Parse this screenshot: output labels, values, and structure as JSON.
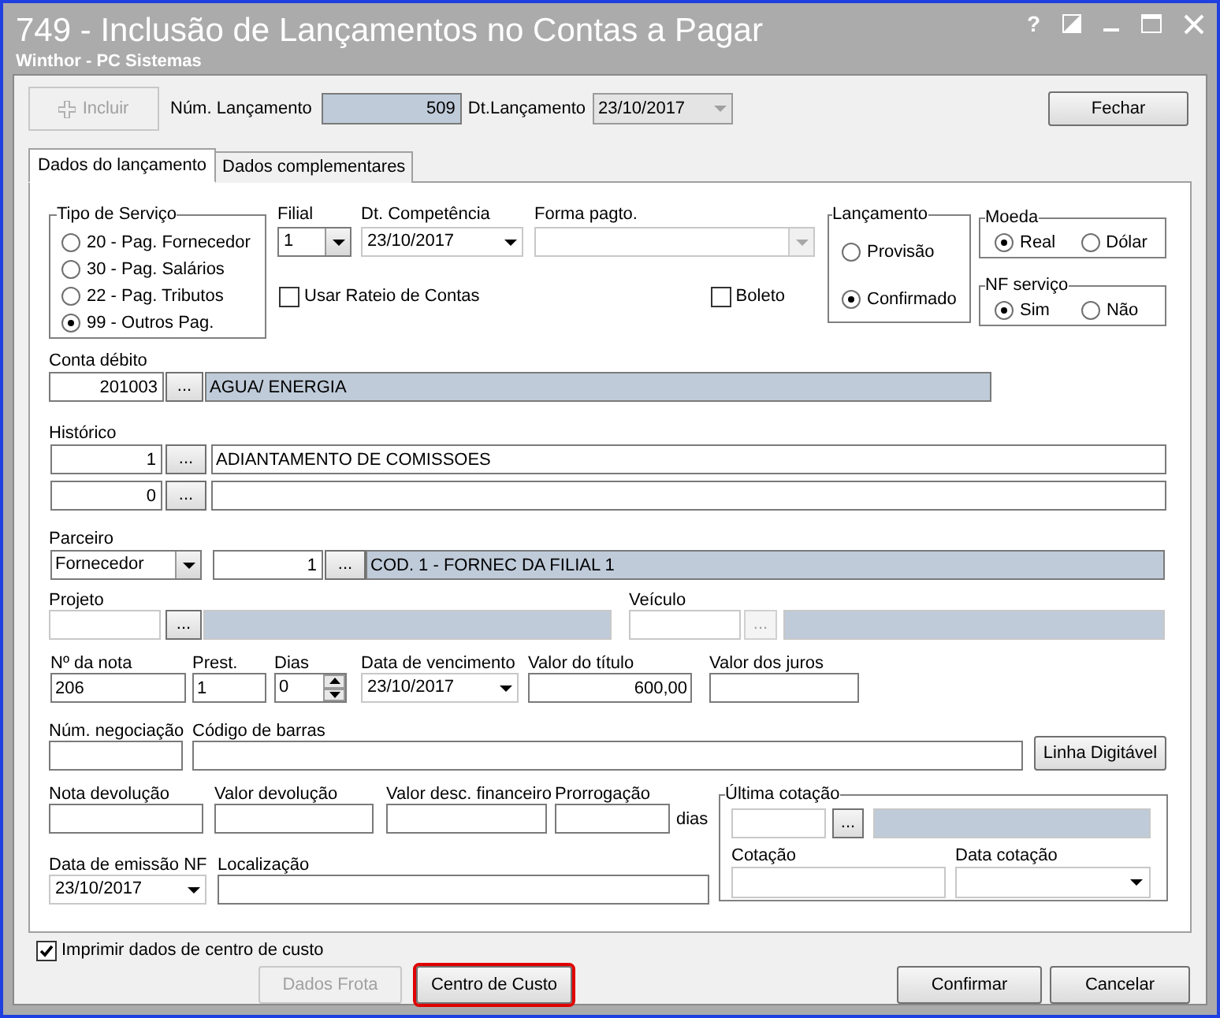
{
  "window": {
    "title": "749 - Inclusão de Lançamentos no Contas a Pagar",
    "subtitle": "Winthor - PC Sistemas",
    "help": "?"
  },
  "toolbar": {
    "add_button": {
      "label": "Incluir",
      "disabled": true
    },
    "entry_number": {
      "label": "Núm. Lançamento",
      "value": "509"
    },
    "entry_date": {
      "label": "Dt.Lançamento",
      "value": "23/10/2017"
    },
    "close_button": {
      "label": "Fechar"
    }
  },
  "tabs": [
    {
      "label": "Dados do lançamento",
      "selected": true
    },
    {
      "label": "Dados complementares",
      "selected": false
    }
  ],
  "service_type": {
    "title": "Tipo de Serviço",
    "options": [
      {
        "label": "20 - Pag. Fornecedor",
        "selected": false
      },
      {
        "label": "30 - Pag. Salários",
        "selected": false
      },
      {
        "label": "22 - Pag. Tributos",
        "selected": false
      },
      {
        "label": "99 - Outros Pag.",
        "selected": true
      }
    ]
  },
  "branch": {
    "label": "Filial",
    "value": "1"
  },
  "competence_date": {
    "label": "Dt. Competência",
    "value": "23/10/2017"
  },
  "payment_method": {
    "label": "Forma pagto."
  },
  "apportion": {
    "label": "Usar Rateio de Contas",
    "checked": false
  },
  "bank_slip": {
    "label": "Boleto",
    "checked": false
  },
  "entry_type": {
    "title": "Lançamento",
    "options": [
      {
        "label": "Provisão",
        "selected": false
      },
      {
        "label": "Confirmado",
        "selected": true
      }
    ]
  },
  "currency": {
    "title": "Moeda",
    "options": [
      {
        "label": "Real",
        "selected": true
      },
      {
        "label": "Dólar",
        "selected": false
      }
    ]
  },
  "service_invoice": {
    "title": "NF serviço",
    "options": [
      {
        "label": "Sim",
        "selected": true
      },
      {
        "label": "Não",
        "selected": false
      }
    ]
  },
  "debit_account": {
    "label": "Conta débito",
    "code": "201003",
    "browse": "...",
    "description": "AGUA/ ENERGIA"
  },
  "history": {
    "label": "Histórico",
    "rows": [
      {
        "code": "1",
        "browse": "...",
        "text": "ADIANTAMENTO DE COMISSOES"
      },
      {
        "code": "0",
        "browse": "..."
      }
    ]
  },
  "partner": {
    "label": "Parceiro",
    "type": "Fornecedor",
    "code": "1",
    "browse": "...",
    "description": "COD. 1 - FORNEC DA FILIAL 1"
  },
  "project": {
    "label": "Projeto",
    "browse": "...",
    "browse_disabled": false
  },
  "vehicle": {
    "label": "Veículo",
    "browse": "...",
    "browse_disabled": true
  },
  "invoice_number": {
    "label": "Nº da nota",
    "value": "206"
  },
  "installment": {
    "label": "Prest.",
    "value": "1"
  },
  "days": {
    "label": "Dias",
    "value": "0"
  },
  "due_date": {
    "label": "Data de vencimento",
    "value": "23/10/2017"
  },
  "amount": {
    "label": "Valor do título",
    "value": "600,00"
  },
  "interest": {
    "label": "Valor dos juros"
  },
  "negotiation_number": {
    "label": "Núm. negociação"
  },
  "barcode": {
    "label": "Código de barras"
  },
  "digitable_line_button": {
    "label": "Linha Digitável"
  },
  "return_invoice": {
    "label": "Nota devolução"
  },
  "return_amount": {
    "label": "Valor devolução"
  },
  "discount_amount": {
    "label": "Valor desc. financeiro"
  },
  "extension": {
    "label": "Prorrogação",
    "unit": "dias"
  },
  "issue_date": {
    "label": "Data de emissão NF",
    "value": "23/10/2017"
  },
  "location": {
    "label": "Localização"
  },
  "last_quote": {
    "title": "Última cotação",
    "browse": "...",
    "quote_label": "Cotação",
    "quote_date_label": "Data cotação"
  },
  "print_cost_center": {
    "label": "Imprimir dados de centro de custo",
    "checked": true
  },
  "footer_buttons": [
    {
      "label": "Dados Frota",
      "disabled": true,
      "highlighted": false
    },
    {
      "label": "Centro de Custo",
      "disabled": false,
      "highlighted": true
    },
    {
      "label": "Confirmar",
      "disabled": false,
      "highlighted": false
    },
    {
      "label": "Cancelar",
      "disabled": false,
      "highlighted": false
    }
  ]
}
